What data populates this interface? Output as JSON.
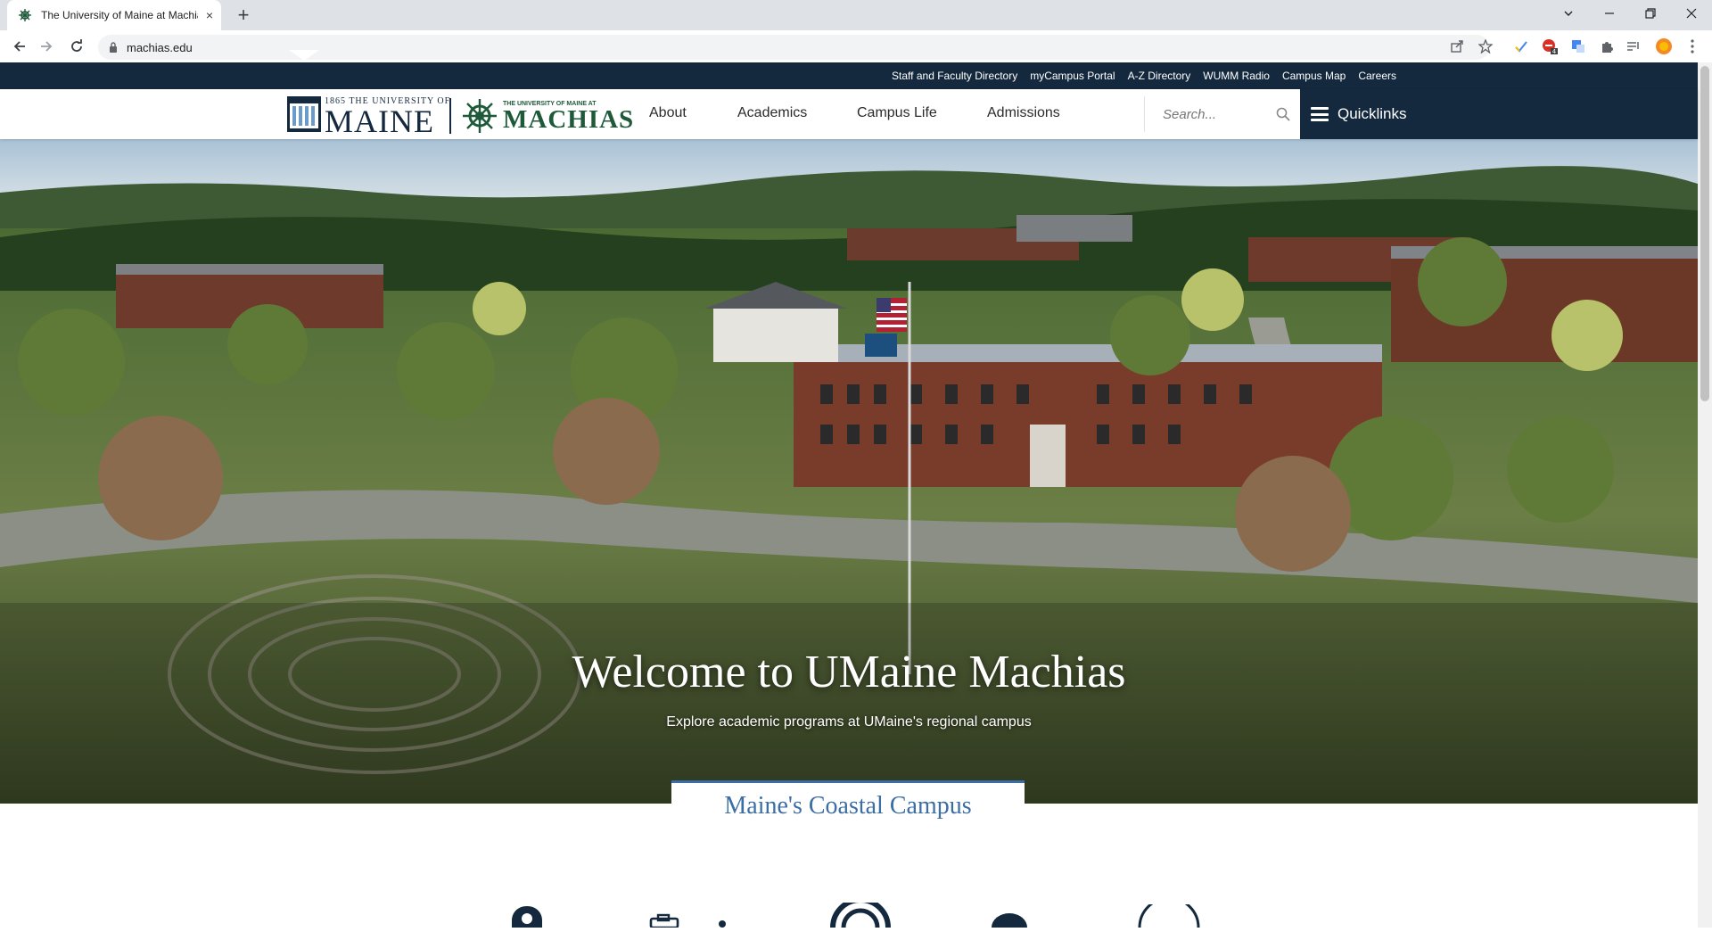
{
  "browser": {
    "tab_title": "The University of Maine at Machias",
    "url": "machias.edu",
    "new_tab_symbol": "+",
    "close_tab_symbol": "×"
  },
  "utility_nav": {
    "links": [
      "Staff and Faculty Directory",
      "myCampus Portal",
      "A-Z Directory",
      "WUMM Radio",
      "Campus Map",
      "Careers"
    ]
  },
  "logo": {
    "maine_small": "1865 THE UNIVERSITY OF",
    "maine_big": "MAINE",
    "machias_small": "THE UNIVERSITY OF MAINE AT",
    "machias_big": "MACHIAS"
  },
  "main_nav": {
    "items": [
      "About",
      "Academics",
      "Campus Life",
      "Admissions"
    ]
  },
  "search": {
    "placeholder": "Search..."
  },
  "quicklinks": {
    "label": "Quicklinks"
  },
  "hero": {
    "title": "Welcome to UMaine Machias",
    "subtitle": "Explore academic programs at UMaine's regional campus"
  },
  "coastal": {
    "label": "Maine's Coastal Campus"
  },
  "colors": {
    "navy": "#14283e",
    "green": "#1e5a3a",
    "accent_blue": "#3a6ea5"
  },
  "icons": [
    "location-icon",
    "camera-icon",
    "radio-icon",
    "person-icon",
    "globe-icon"
  ]
}
